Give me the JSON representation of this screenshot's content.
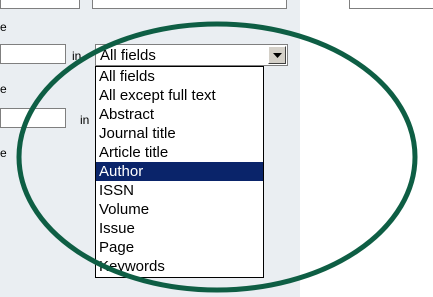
{
  "form": {
    "side_labels": [
      "e",
      "e",
      "e"
    ],
    "in_label": "in",
    "field_select": {
      "selected_value": "All fields",
      "options": [
        "All fields",
        "All except full text",
        "Abstract",
        "Journal title",
        "Article title",
        "Author",
        "ISSN",
        "Volume",
        "Issue",
        "Page",
        "Keywords"
      ],
      "highlighted_option": "Author"
    }
  },
  "annotation": {
    "ellipse_color": "#0e5e44"
  },
  "colors": {
    "panel_background": "#eaeef2",
    "highlight": "#0a246a"
  },
  "icons": {
    "dropdown_arrow": "chevron-down-icon"
  }
}
